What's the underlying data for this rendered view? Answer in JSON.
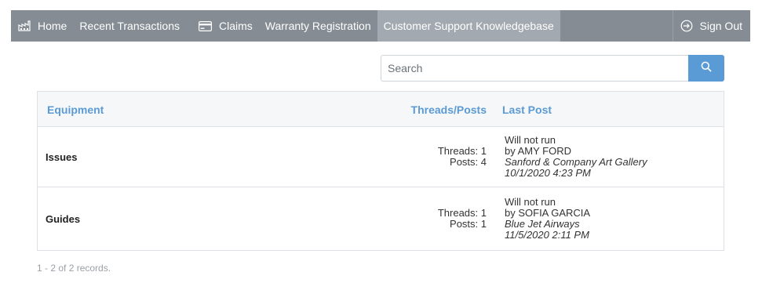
{
  "nav": {
    "items": [
      {
        "label": "Home",
        "icon": "factory-icon"
      },
      {
        "label": "Recent Transactions",
        "icon": ""
      },
      {
        "label": "Claims",
        "icon": "credit-card-icon"
      },
      {
        "label": "Warranty Registration",
        "icon": ""
      },
      {
        "label": "Customer Support Knowledgebase",
        "icon": "",
        "active": true
      }
    ],
    "signout_label": "Sign Out"
  },
  "search": {
    "placeholder": "Search",
    "value": ""
  },
  "grid": {
    "columns": {
      "equipment": "Equipment",
      "threads_posts": "Threads/Posts",
      "last_post": "Last Post"
    },
    "rows": [
      {
        "name": "Issues",
        "threads": "Threads: 1",
        "posts": "Posts: 4",
        "last_title": "Will not run",
        "last_by": "by AMY FORD",
        "last_company": "Sanford & Company Art Gallery",
        "last_date": "10/1/2020 4:23 PM"
      },
      {
        "name": "Guides",
        "threads": "Threads: 1",
        "posts": "Posts: 1",
        "last_title": "Will not run",
        "last_by": "by SOFIA GARCIA",
        "last_company": "Blue Jet Airways",
        "last_date": "11/5/2020 2:11 PM"
      }
    ]
  },
  "footer": {
    "records": "1 - 2 of 2 records."
  },
  "colors": {
    "navbar": "#858c94",
    "nav_active": "#a3a9b0",
    "accent": "#5b9bd5"
  }
}
